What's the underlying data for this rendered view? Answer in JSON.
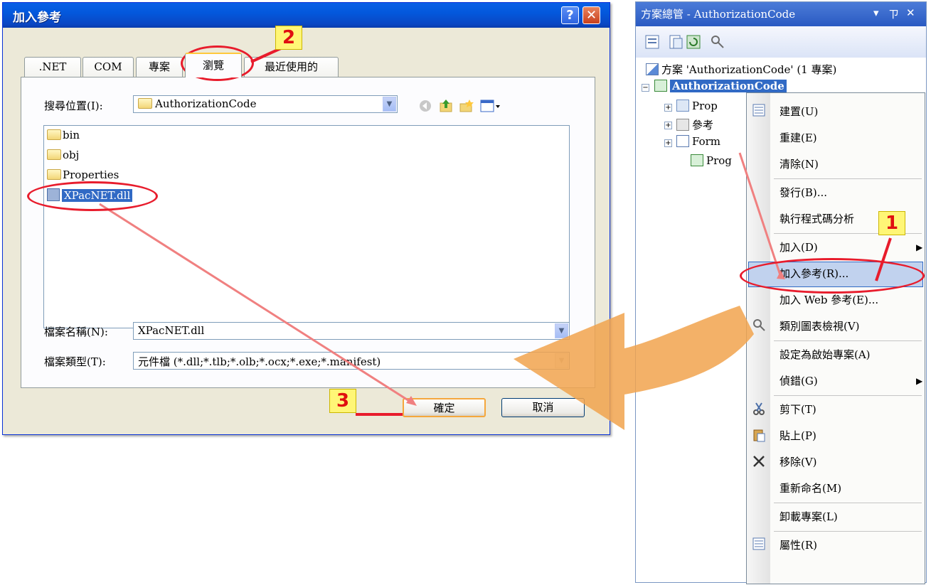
{
  "dialog": {
    "title": "加入參考",
    "help_label": "?",
    "close_label": "✕",
    "tabs": [
      {
        "label": ".NET"
      },
      {
        "label": "COM"
      },
      {
        "label": "專案"
      },
      {
        "label": "瀏覽",
        "active": true
      },
      {
        "label": "最近使用的"
      }
    ],
    "look_in_label": "搜尋位置(I):",
    "look_in_value": "AuthorizationCode",
    "files": [
      {
        "name": "bin",
        "type": "folder"
      },
      {
        "name": "obj",
        "type": "folder"
      },
      {
        "name": "Properties",
        "type": "folder"
      },
      {
        "name": "XPacNET.dll",
        "type": "dll",
        "selected": true
      }
    ],
    "file_name_label": "檔案名稱(N):",
    "file_name_value": "XPacNET.dll",
    "file_type_label": "檔案類型(T):",
    "file_type_value": "元件檔 (*.dll;*.tlb;*.olb;*.ocx;*.exe;*.manifest)",
    "ok_label": "確定",
    "cancel_label": "取消"
  },
  "solution_explorer": {
    "title": "方案總管 - AuthorizationCode",
    "title_controls": [
      "▾",
      "ㄗ",
      "✕"
    ],
    "solution_label": "方案 'AuthorizationCode' (1 專案)",
    "project_label": "AuthorizationCode",
    "children": [
      "Prop",
      "參考",
      "Form",
      "Prog"
    ]
  },
  "context_menu": {
    "items": [
      {
        "label": "建置(U)",
        "icon": "build-icon"
      },
      {
        "label": "重建(E)"
      },
      {
        "label": "清除(N)"
      },
      {
        "label": "發行(B)..."
      },
      {
        "label": "執行程式碼分析"
      },
      {
        "label": "加入(D)",
        "submenu": true
      },
      {
        "label": "加入參考(R)...",
        "highlighted": true
      },
      {
        "label": "加入 Web 參考(E)..."
      },
      {
        "label": "類別圖表檢視(V)",
        "icon": "class-diagram-icon"
      },
      {
        "label": "設定為啟始專案(A)"
      },
      {
        "label": "偵錯(G)",
        "submenu": true
      },
      {
        "label": "剪下(T)",
        "icon": "scissors-icon"
      },
      {
        "label": "貼上(P)",
        "icon": "paste-icon"
      },
      {
        "label": "移除(V)",
        "icon": "delete-icon"
      },
      {
        "label": "重新命名(M)"
      },
      {
        "label": "卸載專案(L)"
      },
      {
        "label": "屬性(R)",
        "icon": "properties-icon"
      }
    ]
  },
  "annotations": {
    "step1": "1",
    "step2": "2",
    "step3": "3"
  },
  "colors": {
    "title_bar_blue": "#0a5fe6",
    "annotation_red": "#e81c2c",
    "callout_yellow": "#fff676",
    "flow_arrow_orange": "#f1a34e",
    "menu_highlight": "#c1d2ee"
  }
}
